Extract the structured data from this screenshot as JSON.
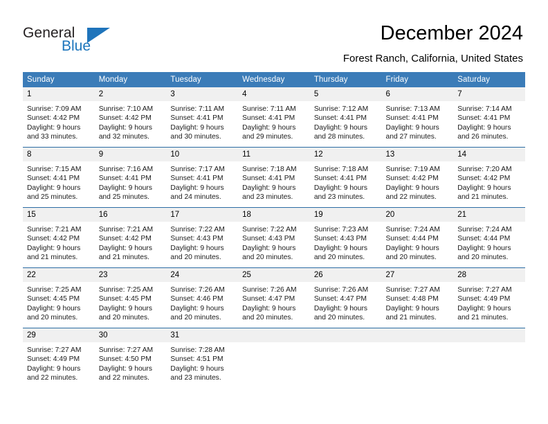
{
  "logo": {
    "word_one": "General",
    "word_two": "Blue",
    "triangle_icon": "triangle-icon"
  },
  "header": {
    "title": "December 2024",
    "subtitle": "Forest Ranch, California, United States"
  },
  "colors": {
    "header_blue": "#3b7cb8",
    "row_divider": "#2b6ca3",
    "daynum_band": "#f0f0f0",
    "logo_blue": "#1c75bc",
    "text": "#000000"
  },
  "weekdays": [
    "Sunday",
    "Monday",
    "Tuesday",
    "Wednesday",
    "Thursday",
    "Friday",
    "Saturday"
  ],
  "labels": {
    "sunrise_prefix": "Sunrise: ",
    "sunset_prefix": "Sunset: ",
    "daylight_prefix": "Daylight: "
  },
  "weeks": [
    [
      {
        "day": "1",
        "sunrise": "Sunrise: 7:09 AM",
        "sunset": "Sunset: 4:42 PM",
        "daylight_line1": "Daylight: 9 hours",
        "daylight_line2": "and 33 minutes."
      },
      {
        "day": "2",
        "sunrise": "Sunrise: 7:10 AM",
        "sunset": "Sunset: 4:42 PM",
        "daylight_line1": "Daylight: 9 hours",
        "daylight_line2": "and 32 minutes."
      },
      {
        "day": "3",
        "sunrise": "Sunrise: 7:11 AM",
        "sunset": "Sunset: 4:41 PM",
        "daylight_line1": "Daylight: 9 hours",
        "daylight_line2": "and 30 minutes."
      },
      {
        "day": "4",
        "sunrise": "Sunrise: 7:11 AM",
        "sunset": "Sunset: 4:41 PM",
        "daylight_line1": "Daylight: 9 hours",
        "daylight_line2": "and 29 minutes."
      },
      {
        "day": "5",
        "sunrise": "Sunrise: 7:12 AM",
        "sunset": "Sunset: 4:41 PM",
        "daylight_line1": "Daylight: 9 hours",
        "daylight_line2": "and 28 minutes."
      },
      {
        "day": "6",
        "sunrise": "Sunrise: 7:13 AM",
        "sunset": "Sunset: 4:41 PM",
        "daylight_line1": "Daylight: 9 hours",
        "daylight_line2": "and 27 minutes."
      },
      {
        "day": "7",
        "sunrise": "Sunrise: 7:14 AM",
        "sunset": "Sunset: 4:41 PM",
        "daylight_line1": "Daylight: 9 hours",
        "daylight_line2": "and 26 minutes."
      }
    ],
    [
      {
        "day": "8",
        "sunrise": "Sunrise: 7:15 AM",
        "sunset": "Sunset: 4:41 PM",
        "daylight_line1": "Daylight: 9 hours",
        "daylight_line2": "and 25 minutes."
      },
      {
        "day": "9",
        "sunrise": "Sunrise: 7:16 AM",
        "sunset": "Sunset: 4:41 PM",
        "daylight_line1": "Daylight: 9 hours",
        "daylight_line2": "and 25 minutes."
      },
      {
        "day": "10",
        "sunrise": "Sunrise: 7:17 AM",
        "sunset": "Sunset: 4:41 PM",
        "daylight_line1": "Daylight: 9 hours",
        "daylight_line2": "and 24 minutes."
      },
      {
        "day": "11",
        "sunrise": "Sunrise: 7:18 AM",
        "sunset": "Sunset: 4:41 PM",
        "daylight_line1": "Daylight: 9 hours",
        "daylight_line2": "and 23 minutes."
      },
      {
        "day": "12",
        "sunrise": "Sunrise: 7:18 AM",
        "sunset": "Sunset: 4:41 PM",
        "daylight_line1": "Daylight: 9 hours",
        "daylight_line2": "and 23 minutes."
      },
      {
        "day": "13",
        "sunrise": "Sunrise: 7:19 AM",
        "sunset": "Sunset: 4:42 PM",
        "daylight_line1": "Daylight: 9 hours",
        "daylight_line2": "and 22 minutes."
      },
      {
        "day": "14",
        "sunrise": "Sunrise: 7:20 AM",
        "sunset": "Sunset: 4:42 PM",
        "daylight_line1": "Daylight: 9 hours",
        "daylight_line2": "and 21 minutes."
      }
    ],
    [
      {
        "day": "15",
        "sunrise": "Sunrise: 7:21 AM",
        "sunset": "Sunset: 4:42 PM",
        "daylight_line1": "Daylight: 9 hours",
        "daylight_line2": "and 21 minutes."
      },
      {
        "day": "16",
        "sunrise": "Sunrise: 7:21 AM",
        "sunset": "Sunset: 4:42 PM",
        "daylight_line1": "Daylight: 9 hours",
        "daylight_line2": "and 21 minutes."
      },
      {
        "day": "17",
        "sunrise": "Sunrise: 7:22 AM",
        "sunset": "Sunset: 4:43 PM",
        "daylight_line1": "Daylight: 9 hours",
        "daylight_line2": "and 20 minutes."
      },
      {
        "day": "18",
        "sunrise": "Sunrise: 7:22 AM",
        "sunset": "Sunset: 4:43 PM",
        "daylight_line1": "Daylight: 9 hours",
        "daylight_line2": "and 20 minutes."
      },
      {
        "day": "19",
        "sunrise": "Sunrise: 7:23 AM",
        "sunset": "Sunset: 4:43 PM",
        "daylight_line1": "Daylight: 9 hours",
        "daylight_line2": "and 20 minutes."
      },
      {
        "day": "20",
        "sunrise": "Sunrise: 7:24 AM",
        "sunset": "Sunset: 4:44 PM",
        "daylight_line1": "Daylight: 9 hours",
        "daylight_line2": "and 20 minutes."
      },
      {
        "day": "21",
        "sunrise": "Sunrise: 7:24 AM",
        "sunset": "Sunset: 4:44 PM",
        "daylight_line1": "Daylight: 9 hours",
        "daylight_line2": "and 20 minutes."
      }
    ],
    [
      {
        "day": "22",
        "sunrise": "Sunrise: 7:25 AM",
        "sunset": "Sunset: 4:45 PM",
        "daylight_line1": "Daylight: 9 hours",
        "daylight_line2": "and 20 minutes."
      },
      {
        "day": "23",
        "sunrise": "Sunrise: 7:25 AM",
        "sunset": "Sunset: 4:45 PM",
        "daylight_line1": "Daylight: 9 hours",
        "daylight_line2": "and 20 minutes."
      },
      {
        "day": "24",
        "sunrise": "Sunrise: 7:26 AM",
        "sunset": "Sunset: 4:46 PM",
        "daylight_line1": "Daylight: 9 hours",
        "daylight_line2": "and 20 minutes."
      },
      {
        "day": "25",
        "sunrise": "Sunrise: 7:26 AM",
        "sunset": "Sunset: 4:47 PM",
        "daylight_line1": "Daylight: 9 hours",
        "daylight_line2": "and 20 minutes."
      },
      {
        "day": "26",
        "sunrise": "Sunrise: 7:26 AM",
        "sunset": "Sunset: 4:47 PM",
        "daylight_line1": "Daylight: 9 hours",
        "daylight_line2": "and 20 minutes."
      },
      {
        "day": "27",
        "sunrise": "Sunrise: 7:27 AM",
        "sunset": "Sunset: 4:48 PM",
        "daylight_line1": "Daylight: 9 hours",
        "daylight_line2": "and 21 minutes."
      },
      {
        "day": "28",
        "sunrise": "Sunrise: 7:27 AM",
        "sunset": "Sunset: 4:49 PM",
        "daylight_line1": "Daylight: 9 hours",
        "daylight_line2": "and 21 minutes."
      }
    ],
    [
      {
        "day": "29",
        "sunrise": "Sunrise: 7:27 AM",
        "sunset": "Sunset: 4:49 PM",
        "daylight_line1": "Daylight: 9 hours",
        "daylight_line2": "and 22 minutes."
      },
      {
        "day": "30",
        "sunrise": "Sunrise: 7:27 AM",
        "sunset": "Sunset: 4:50 PM",
        "daylight_line1": "Daylight: 9 hours",
        "daylight_line2": "and 22 minutes."
      },
      {
        "day": "31",
        "sunrise": "Sunrise: 7:28 AM",
        "sunset": "Sunset: 4:51 PM",
        "daylight_line1": "Daylight: 9 hours",
        "daylight_line2": "and 23 minutes."
      },
      {
        "day": "",
        "sunrise": "",
        "sunset": "",
        "daylight_line1": "",
        "daylight_line2": ""
      },
      {
        "day": "",
        "sunrise": "",
        "sunset": "",
        "daylight_line1": "",
        "daylight_line2": ""
      },
      {
        "day": "",
        "sunrise": "",
        "sunset": "",
        "daylight_line1": "",
        "daylight_line2": ""
      },
      {
        "day": "",
        "sunrise": "",
        "sunset": "",
        "daylight_line1": "",
        "daylight_line2": ""
      }
    ]
  ]
}
